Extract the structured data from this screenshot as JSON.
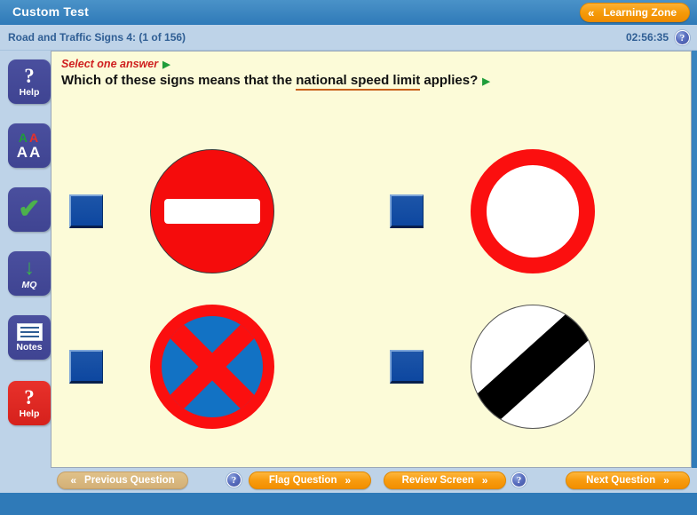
{
  "window": {
    "title": "Custom Test"
  },
  "header": {
    "learning_zone_label": "Learning Zone",
    "learning_zone_chevron": "«",
    "breadcrumb": "Road and Traffic Signs 4:   (1 of 156)",
    "timer": "02:56:35",
    "help_orb_glyph": "?"
  },
  "sidebar": {
    "items": [
      {
        "name": "help-top",
        "glyph": "?",
        "label": "Help",
        "icon": "question-mark-icon",
        "style": "blue"
      },
      {
        "name": "text-size",
        "glyph": "",
        "label": "",
        "icon": "text-size-aa-icon",
        "style": "blue",
        "aa": {
          "top_left": "A",
          "top_right": "A",
          "bottom_left": "A",
          "bottom_right": "A"
        }
      },
      {
        "name": "confirm",
        "glyph": "✔",
        "label": "",
        "icon": "green-check-icon",
        "style": "blue"
      },
      {
        "name": "mark-question",
        "glyph": "↓",
        "label": "MQ",
        "icon": "green-down-arrow-icon",
        "style": "blue"
      },
      {
        "name": "notes",
        "glyph": "",
        "label": "Notes",
        "icon": "notepad-icon",
        "style": "blue"
      },
      {
        "name": "help-bottom",
        "glyph": "?",
        "label": "Help",
        "icon": "question-mark-icon",
        "style": "red"
      }
    ]
  },
  "question": {
    "instruction": "Select one answer",
    "instruction_marker": "▶",
    "text_before": "Which of these signs means that the ",
    "text_highlight": "national speed limit",
    "text_after": " applies?",
    "text_marker": "▶",
    "answers": [
      {
        "id": "a",
        "checkbox_state": "unchecked",
        "sign": "no-entry-sign",
        "sign_desc": "No entry"
      },
      {
        "id": "b",
        "checkbox_state": "unchecked",
        "sign": "no-vehicles-sign",
        "sign_desc": "No vehicles"
      },
      {
        "id": "c",
        "checkbox_state": "unchecked",
        "sign": "no-stopping-sign",
        "sign_desc": "No stopping (clearway)"
      },
      {
        "id": "d",
        "checkbox_state": "unchecked",
        "sign": "national-speed-limit-sign",
        "sign_desc": "National speed limit applies"
      }
    ]
  },
  "bottom_bar": {
    "previous_label": "Previous Question",
    "previous_chevron": "«",
    "flag_label": "Flag Question",
    "flag_chevron": "»",
    "review_label": "Review Screen",
    "review_chevron": "»",
    "next_label": "Next Question",
    "next_chevron": "»",
    "help_orb_glyph": "?"
  },
  "colors": {
    "title_bar": "#2f7ab8",
    "sub_header": "#bed3e8",
    "content_bg": "#fcfbd8",
    "accent_orange": "#f59b0a",
    "instruction_red": "#cf1f1f",
    "checkbox_blue": "#0d47a0",
    "sign_red": "#fb0f0f",
    "sign_blue": "#1272c4"
  }
}
